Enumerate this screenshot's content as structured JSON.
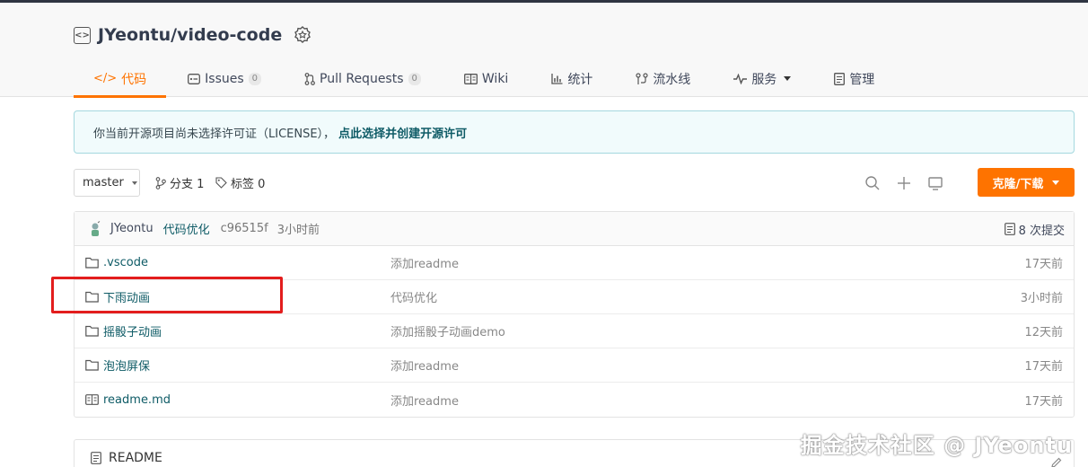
{
  "repo": {
    "name": "JYeontu/video-code",
    "icon": "code-brackets-icon"
  },
  "tabs": [
    {
      "label": "代码",
      "icon": "</>"
    },
    {
      "label": "Issues",
      "count": "0"
    },
    {
      "label": "Pull Requests",
      "count": "0"
    },
    {
      "label": "Wiki"
    },
    {
      "label": "统计"
    },
    {
      "label": "流水线"
    },
    {
      "label": "服务"
    },
    {
      "label": "管理"
    }
  ],
  "notice": {
    "text": "你当前开源项目尚未选择许可证（LICENSE），",
    "link": "点此选择并创建开源许可"
  },
  "toolbar": {
    "branch": "master",
    "branches_label": "分支 1",
    "tags_label": "标签 0",
    "clone_label": "克隆/下载"
  },
  "commit": {
    "author": "JYeontu",
    "message": "代码优化",
    "sha": "c96515f",
    "time": "3小时前",
    "commits_label": "8 次提交"
  },
  "files": [
    {
      "name": ".vscode",
      "type": "folder",
      "message": "添加readme",
      "time": "17天前"
    },
    {
      "name": "下雨动画",
      "type": "folder",
      "message": "代码优化",
      "time": "3小时前"
    },
    {
      "name": "摇骰子动画",
      "type": "folder",
      "message": "添加摇骰子动画demo",
      "time": "12天前"
    },
    {
      "name": "泡泡屏保",
      "type": "folder",
      "message": "添加readme",
      "time": "17天前"
    },
    {
      "name": "readme.md",
      "type": "file",
      "message": "添加readme",
      "time": "17天前"
    }
  ],
  "readme": {
    "title": "README"
  },
  "watermark": "掘金技术社区 @ JYeontu",
  "colors": {
    "accent": "#fe7300",
    "link": "#0e5b66",
    "highlight": "#e31d1d"
  }
}
